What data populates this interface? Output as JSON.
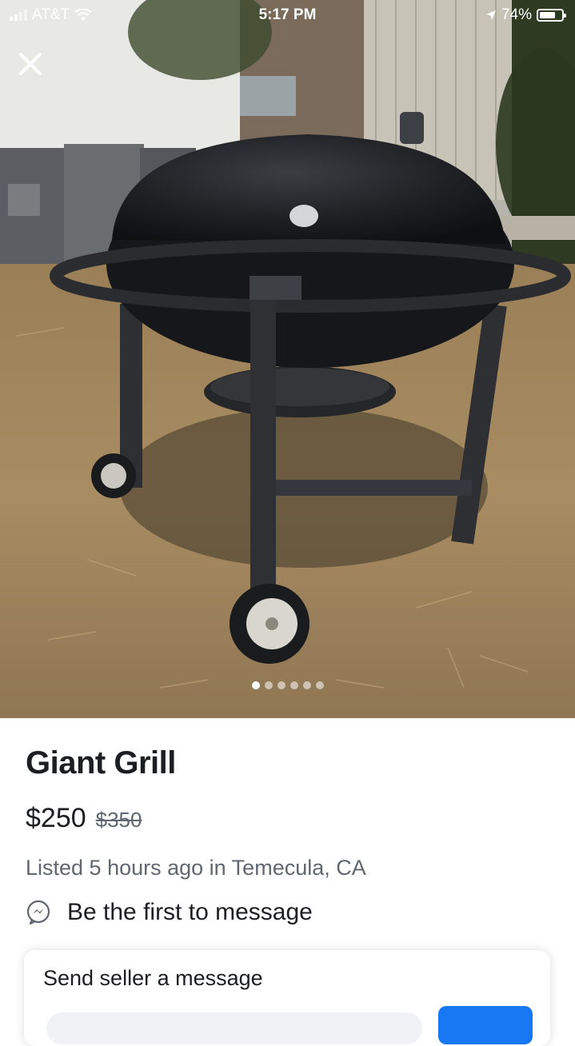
{
  "status_bar": {
    "carrier": "AT&T",
    "time": "5:17 PM",
    "battery_percent": "74%",
    "battery_level": 0.74,
    "icons": [
      "signal-icon",
      "wifi-icon",
      "location-arrow-icon",
      "battery-icon"
    ]
  },
  "photo": {
    "description_icon": "grill-photo",
    "carousel_count": 6,
    "carousel_active_index": 0
  },
  "listing": {
    "title": "Giant Grill",
    "price": "$250",
    "original_price": "$350",
    "listed_info": "Listed 5 hours ago in Temecula, CA",
    "first_message_text": "Be the first to message"
  },
  "message_card": {
    "title": "Send seller a message"
  },
  "colors": {
    "accent": "#1877f2",
    "text_primary": "#1c1e21",
    "text_secondary": "#606770"
  }
}
